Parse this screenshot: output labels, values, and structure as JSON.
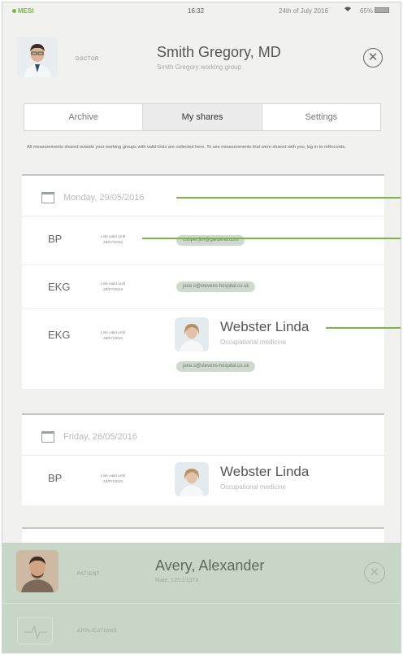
{
  "status_bar": {
    "brand": "MESI",
    "time": "16:32",
    "date": "24th of July 2016",
    "battery": "65%"
  },
  "doctor": {
    "role": "DOCTOR",
    "name": "Smith Gregory, MD",
    "group": "Smith Gregory working group"
  },
  "tabs": [
    {
      "label": "Archive",
      "active": false
    },
    {
      "label": "My shares",
      "active": true
    },
    {
      "label": "Settings",
      "active": false
    }
  ],
  "notice": "All measurements shared outside your working groups with valid links are collected here. To see measurements that were shared with you, log in to mRecords.",
  "groups": [
    {
      "date": "Monday, 29/05/2016",
      "shares": [
        {
          "type": "BP",
          "link_valid_label": "Link valid until",
          "link_valid_date": "29/07/2016",
          "email": "cooper.jim@gardena.com"
        },
        {
          "type": "EKG",
          "link_valid_label": "Link valid until",
          "link_valid_date": "29/07/2016",
          "email": "jane.s@stevens-hospital.co.uk"
        },
        {
          "type": "EKG",
          "link_valid_label": "Link valid until",
          "link_valid_date": "29/07/2016",
          "contact_name": "Webster Linda",
          "contact_specialty": "Occupational medicine",
          "email": "jane.s@stevens-hospital.co.uk"
        }
      ]
    },
    {
      "date": "Friday, 26/05/2016",
      "shares": [
        {
          "type": "BP",
          "link_valid_label": "Link valid until",
          "link_valid_date": "24/07/2016",
          "contact_name": "Webster Linda",
          "contact_specialty": "Occupational medicine"
        }
      ]
    }
  ],
  "patient": {
    "role": "PATIENT",
    "name": "Avery, Alexander",
    "sub": "Male, 12/11/1974"
  },
  "applications": {
    "label": "APPLICATIONS"
  },
  "colors": {
    "accent": "#7cb34a",
    "chip": "#cfdacf",
    "patient_panel": "#c4d4c4"
  }
}
